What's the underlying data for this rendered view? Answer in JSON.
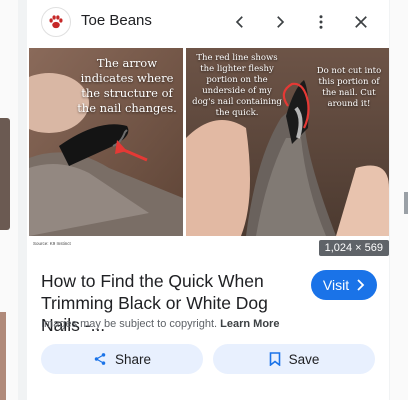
{
  "header": {
    "site_name": "Toe Beans",
    "logo_icon": "paw-print-icon"
  },
  "image": {
    "caption_left": "The arrow indicates where the structure of the nail changes.",
    "caption_middle": "The red line shows the lighter fleshy portion on the underside of my dog's nail containing the quick.",
    "caption_right": "Do not cut into this portion of the nail. Cut around it!",
    "source_credit": "Source: K9 Instinct",
    "dimensions": "1,024 × 569"
  },
  "result": {
    "title": "How to Find the Quick When Trimming Black or White Dog Nails -...",
    "visit_label": "Visit",
    "copyright_note": "Images may be subject to copyright.",
    "learn_more": "Learn More"
  },
  "actions": {
    "share_label": "Share",
    "save_label": "Save"
  },
  "colors": {
    "accent": "#1a73e8",
    "action_bg": "#e8f0fe",
    "paw": "#c62828"
  }
}
